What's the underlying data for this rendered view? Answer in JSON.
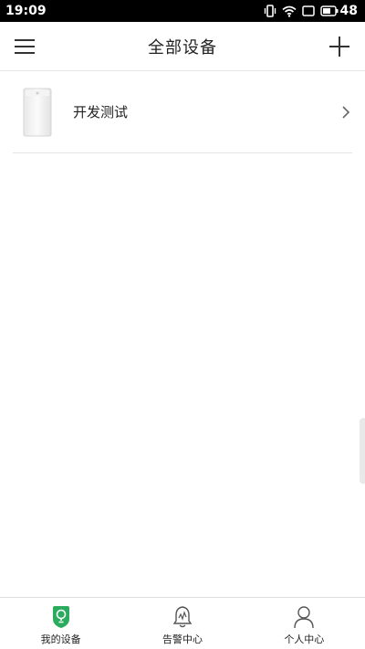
{
  "status_bar": {
    "time": "19:09",
    "battery": "48",
    "icons": [
      "vibrate-icon",
      "wifi-icon",
      "message-icon",
      "battery-icon"
    ]
  },
  "header": {
    "title": "全部设备",
    "menu_icon": "hamburger-icon",
    "add_icon": "plus-icon"
  },
  "devices": [
    {
      "name": "开发测试",
      "icon": "air-purifier-icon"
    }
  ],
  "tabs": [
    {
      "label": "我的设备",
      "icon": "device-shield-icon",
      "active": true
    },
    {
      "label": "告警中心",
      "icon": "alarm-bell-icon",
      "active": false
    },
    {
      "label": "个人中心",
      "icon": "person-icon",
      "active": false
    }
  ],
  "colors": {
    "accent": "#2bab5e",
    "text": "#222222",
    "divider": "#e4e4e4"
  }
}
